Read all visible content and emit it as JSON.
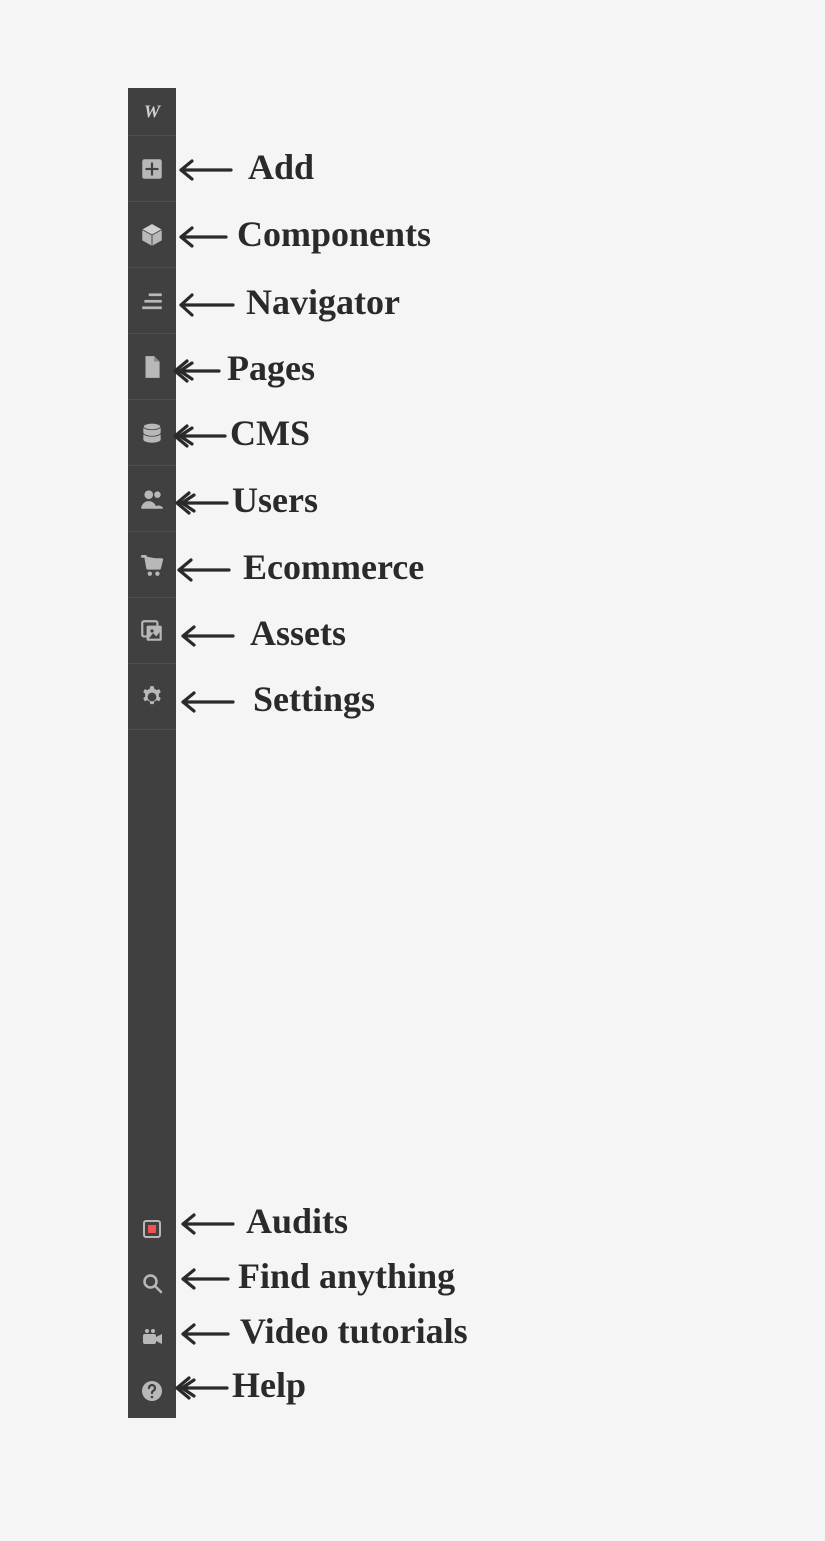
{
  "logo": {
    "letter": "W"
  },
  "sidebar": {
    "top_items": [
      {
        "id": "add",
        "label": "Add",
        "icon": "plus-box-icon"
      },
      {
        "id": "components",
        "label": "Components",
        "icon": "cube-icon"
      },
      {
        "id": "navigator",
        "label": "Navigator",
        "icon": "navigator-icon"
      },
      {
        "id": "pages",
        "label": "Pages",
        "icon": "page-icon"
      },
      {
        "id": "cms",
        "label": "CMS",
        "icon": "database-icon"
      },
      {
        "id": "users",
        "label": "Users",
        "icon": "users-icon"
      },
      {
        "id": "ecommerce",
        "label": "Ecommerce",
        "icon": "cart-icon"
      },
      {
        "id": "assets",
        "label": "Assets",
        "icon": "assets-icon"
      },
      {
        "id": "settings",
        "label": "Settings",
        "icon": "gear-icon"
      }
    ],
    "bottom_items": [
      {
        "id": "audits",
        "label": "Audits",
        "icon": "audits-icon"
      },
      {
        "id": "search",
        "label": "Find anything",
        "icon": "search-icon"
      },
      {
        "id": "video",
        "label": "Video tutorials",
        "icon": "video-icon"
      },
      {
        "id": "help",
        "label": "Help",
        "icon": "help-icon"
      }
    ]
  },
  "colors": {
    "sidebar_bg": "#404040",
    "icon_fill": "#b8b8b8",
    "audits_red": "#f05252"
  }
}
